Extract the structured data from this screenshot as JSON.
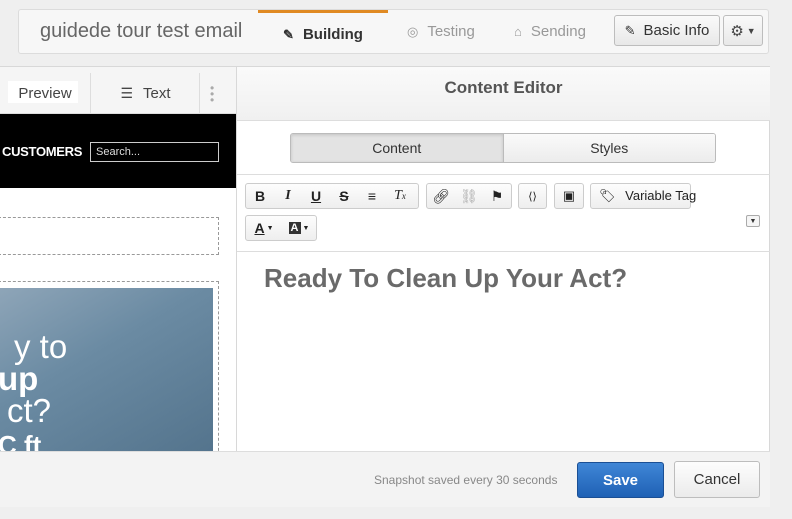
{
  "header": {
    "email_name": "guidede tour test email",
    "tabs": [
      {
        "label": "Building",
        "icon": "edit-icon",
        "active": true
      },
      {
        "label": "Testing",
        "icon": "target-icon",
        "active": false
      },
      {
        "label": "Sending",
        "icon": "inbox-icon",
        "active": false
      }
    ],
    "basic_info_label": "Basic Info",
    "accent_color": "#e08a23"
  },
  "left_pane": {
    "preview_label": "Preview",
    "text_label": "Text",
    "banner_text": "CUSTOMERS",
    "search_placeholder": "Search...",
    "hero_lines": [
      "y to",
      "up",
      "ct?",
      "C ft"
    ]
  },
  "editor": {
    "title": "Content Editor",
    "tabs": [
      {
        "label": "Content",
        "active": true
      },
      {
        "label": "Styles",
        "active": false
      }
    ],
    "toolbar": {
      "bold": "B",
      "italic": "I",
      "underline": "U",
      "strike": "S",
      "variable_tag_label": "Variable Tag",
      "font_color": "A",
      "bg_color": "A"
    },
    "content_heading": "Ready To Clean Up Your Act?"
  },
  "footer": {
    "snapshot_text": "Snapshot saved every 30 seconds",
    "save_label": "Save",
    "cancel_label": "Cancel",
    "save_color": "#2a6fc4"
  }
}
